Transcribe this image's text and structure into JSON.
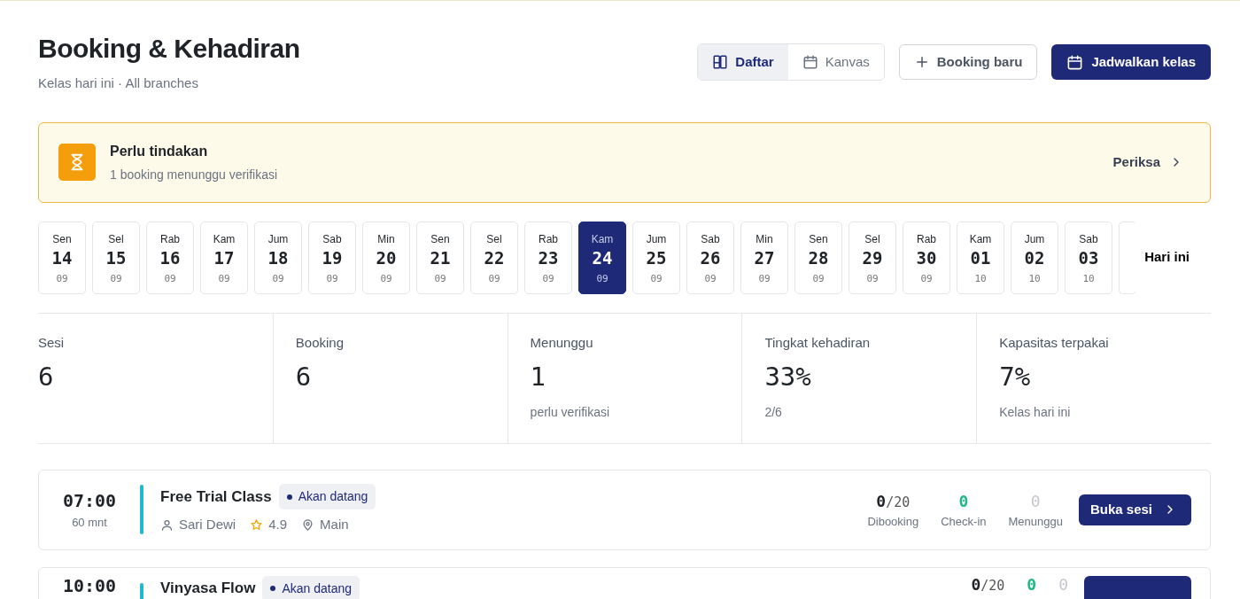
{
  "header": {
    "title": "Booking & Kehadiran",
    "subtitle": "Kelas hari ini · All branches"
  },
  "view_toggle": [
    {
      "label": "Daftar",
      "kind": "list",
      "selected": true
    },
    {
      "label": "Kanvas",
      "kind": "calendar",
      "selected": false
    }
  ],
  "buttons": [
    {
      "label": "Booking baru",
      "kind": "outline"
    },
    {
      "label": "Jadwalkan kelas",
      "kind": "primary"
    }
  ],
  "alert": {
    "title": "Perlu tindakan",
    "text": "1 booking menunggu verifikasi",
    "action": "Periksa"
  },
  "dates": [
    {
      "day": "Sen",
      "date": "14",
      "month": "09",
      "selected": false
    },
    {
      "day": "Sel",
      "date": "15",
      "month": "09",
      "selected": false
    },
    {
      "day": "Rab",
      "date": "16",
      "month": "09",
      "selected": false
    },
    {
      "day": "Kam",
      "date": "17",
      "month": "09",
      "selected": false
    },
    {
      "day": "Jum",
      "date": "18",
      "month": "09",
      "selected": false
    },
    {
      "day": "Sab",
      "date": "19",
      "month": "09",
      "selected": false
    },
    {
      "day": "Min",
      "date": "20",
      "month": "09",
      "selected": false
    },
    {
      "day": "Sen",
      "date": "21",
      "month": "09",
      "selected": false
    },
    {
      "day": "Sel",
      "date": "22",
      "month": "09",
      "selected": false
    },
    {
      "day": "Rab",
      "date": "23",
      "month": "09",
      "selected": false
    },
    {
      "day": "Kam",
      "date": "24",
      "month": "09",
      "selected": true
    },
    {
      "day": "Jum",
      "date": "25",
      "month": "09",
      "selected": false
    },
    {
      "day": "Sab",
      "date": "26",
      "month": "09",
      "selected": false
    },
    {
      "day": "Min",
      "date": "27",
      "month": "09",
      "selected": false
    },
    {
      "day": "Sen",
      "date": "28",
      "month": "09",
      "selected": false
    },
    {
      "day": "Sel",
      "date": "29",
      "month": "09",
      "selected": false
    },
    {
      "day": "Rab",
      "date": "30",
      "month": "09",
      "selected": false
    },
    {
      "day": "Kam",
      "date": "01",
      "month": "10",
      "selected": false
    },
    {
      "day": "Jum",
      "date": "02",
      "month": "10",
      "selected": false
    },
    {
      "day": "Sab",
      "date": "03",
      "month": "10",
      "selected": false
    }
  ],
  "today_button": "Hari ini",
  "stats": [
    {
      "label": "Sesi",
      "value": "6"
    },
    {
      "label": "Booking",
      "value": "6"
    },
    {
      "label": "Menunggu",
      "value": "1",
      "note": "perlu verifikasi"
    },
    {
      "label": "Tingkat kehadiran",
      "value": "33%",
      "note": "2/6"
    },
    {
      "label": "Kapasitas terpakai",
      "value": "7%",
      "note": "Kelas hari ini"
    }
  ],
  "sessions": [
    {
      "time": "07:00",
      "duration": "60 mnt",
      "name": "Free Trial Class",
      "status": "Akan datang",
      "instructor": "Sari Dewi",
      "rating": "4.9",
      "location": "Main",
      "booked": "0",
      "capacity": "/20",
      "booked_label": "Dibooking",
      "checkin": "0",
      "checkin_label": "Check-in",
      "waiting": "0",
      "waiting_label": "Menunggu",
      "action": "Buka sesi"
    },
    {
      "time": "10:00",
      "name": "Vinyasa Flow",
      "status": "Akan datang",
      "booked": "0",
      "capacity": "/20",
      "checkin": "0",
      "waiting": "0"
    }
  ]
}
